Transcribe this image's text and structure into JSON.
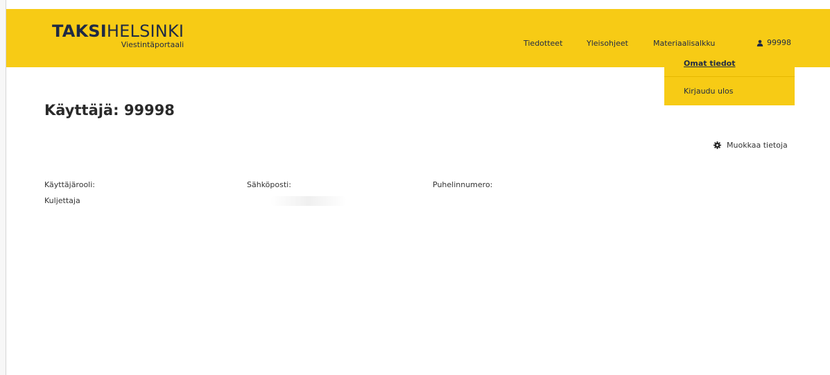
{
  "logo": {
    "bold": "TAKSI",
    "light": "HELSINKI",
    "subtitle": "Viestintäportaali"
  },
  "nav": {
    "items": [
      "Tiedotteet",
      "Yleisohjeet",
      "Materiaalisalkku"
    ],
    "user": "99998"
  },
  "dropdown": {
    "items": [
      "Omat tiedot",
      "Kirjaudu ulos"
    ]
  },
  "page": {
    "title": "Käyttäjä: 99998",
    "edit_label": "Muokkaa tietoja"
  },
  "fields": {
    "role_label": "Käyttäjärooli:",
    "role_value": "Kuljettaja",
    "email_label": "Sähköposti:",
    "email_value": "",
    "phone_label": "Puhelinnumero:",
    "phone_value": ""
  },
  "colors": {
    "brand_yellow": "#f7cb15",
    "brand_navy": "#1f2a44"
  }
}
